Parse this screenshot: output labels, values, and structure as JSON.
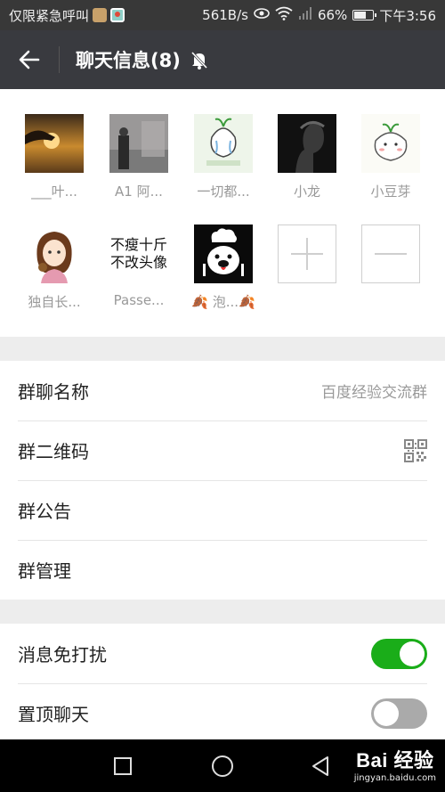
{
  "status_bar": {
    "left_text": "仅限紧急呼叫",
    "speed": "561B/s",
    "battery": "66%",
    "battery_level": 0.66,
    "time": "下午3:56",
    "icons": [
      "bag-icon",
      "map-icon",
      "eye-icon",
      "wifi-icon",
      "signal-icon",
      "battery-icon"
    ]
  },
  "header": {
    "title": "聊天信息(8)",
    "icons": [
      "back-arrow-icon",
      "mute-bell-icon"
    ]
  },
  "members": [
    {
      "name": "___叶...",
      "avatar": "sunset-hand-photo"
    },
    {
      "name": "A1  阿...",
      "avatar": "man-photo"
    },
    {
      "name": "一切都...",
      "avatar": "crying-sprout-cartoon"
    },
    {
      "name": "小龙",
      "avatar": "silhouette-photo"
    },
    {
      "name": "小豆芽",
      "avatar": "sprout-cartoon"
    },
    {
      "name": "独自长...",
      "avatar": "girl-cartoon"
    },
    {
      "name": "Passe...",
      "avatar": "text-avatar",
      "avatar_text": [
        "不瘦十斤",
        "不改头像"
      ]
    },
    {
      "name": "🍂 泡...🍂",
      "avatar": "chef-bear-cartoon"
    }
  ],
  "member_controls": {
    "add": "add-member-icon",
    "remove": "remove-member-icon"
  },
  "settings": {
    "group_name_label": "群聊名称",
    "group_name_value": "百度经验交流群",
    "qr_label": "群二维码",
    "notice_label": "群公告",
    "manage_label": "群管理",
    "dnd_label": "消息免打扰",
    "dnd_on": true,
    "pin_label": "置顶聊天",
    "pin_on": false
  },
  "colors": {
    "header_bg": "#393a3f",
    "toggle_on": "#1aad19",
    "toggle_off": "#aaaaaa"
  },
  "nav_bar": {
    "icons": [
      "square-recent-icon",
      "circle-home-icon",
      "triangle-back-icon"
    ]
  },
  "watermark": {
    "logo": "Bai  经验",
    "url": "jingyan.baidu.com"
  }
}
